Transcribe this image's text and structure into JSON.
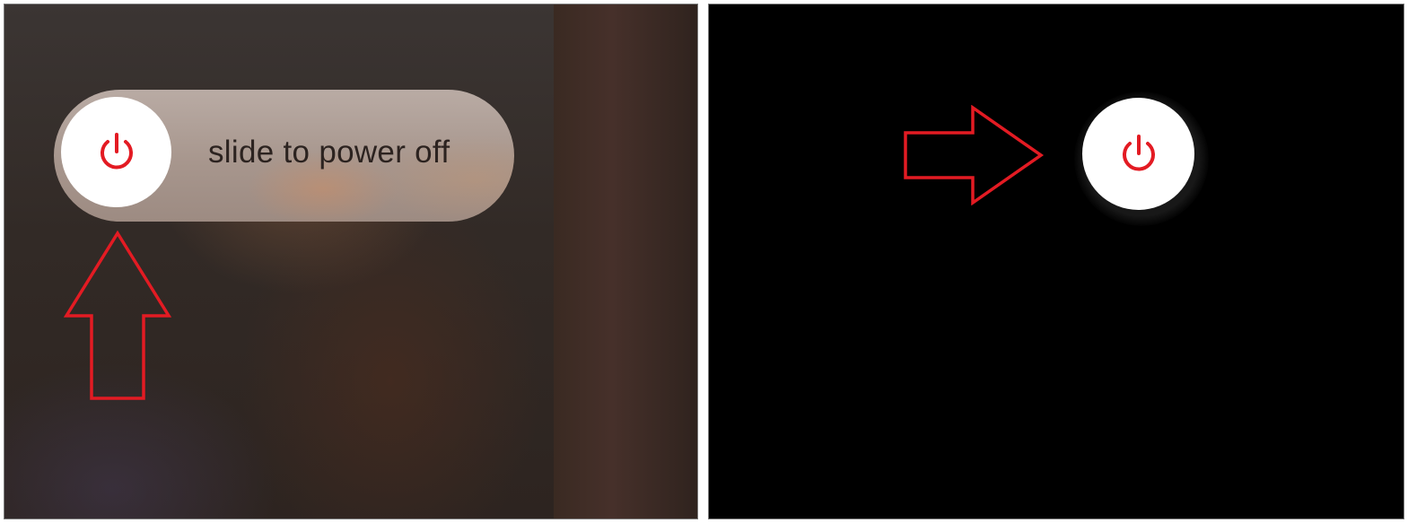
{
  "left_panel": {
    "slider": {
      "label": "slide to power off",
      "knob_icon": "power-icon",
      "progress": 0
    },
    "annotation_arrow": {
      "icon": "arrow-up-outline",
      "color": "#e31b23"
    }
  },
  "right_panel": {
    "power_button": {
      "icon": "power-icon"
    },
    "annotation_arrow": {
      "icon": "arrow-right-outline",
      "color": "#e31b23"
    }
  },
  "colors": {
    "accent": "#e31b23",
    "knob": "#ffffff",
    "right_background": "#000000"
  }
}
